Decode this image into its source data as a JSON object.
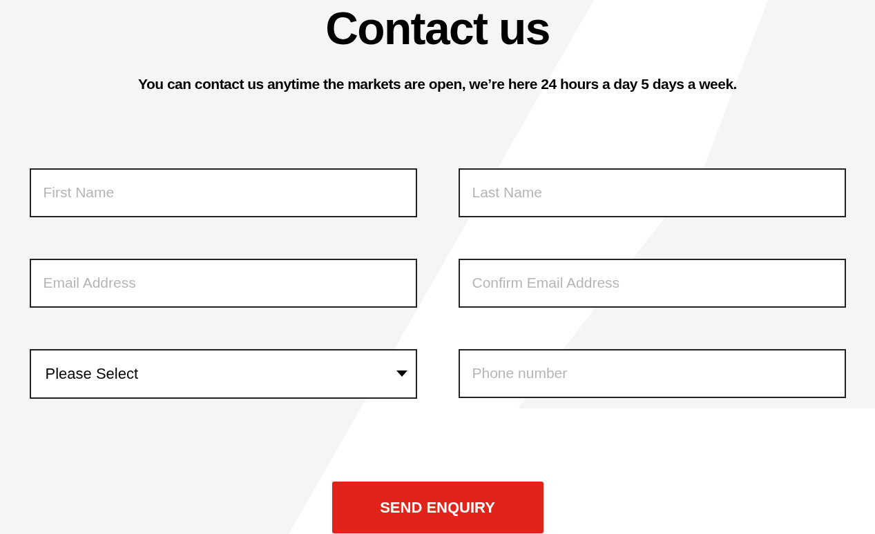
{
  "title": "Contact us",
  "subtitle": "You can contact us anytime the markets are open, we’re here 24 hours a day 5 days a week.",
  "fields": [
    {
      "kind": "input",
      "placeholder": "First Name"
    },
    {
      "kind": "input",
      "placeholder": "Last Name"
    },
    {
      "kind": "input",
      "placeholder": "Email Address"
    },
    {
      "kind": "input",
      "placeholder": "Confirm Email Address"
    },
    {
      "kind": "select",
      "value": "Please Select"
    },
    {
      "kind": "input",
      "placeholder": "Phone number"
    }
  ],
  "submit_button": "SEND ENQUIRY"
}
